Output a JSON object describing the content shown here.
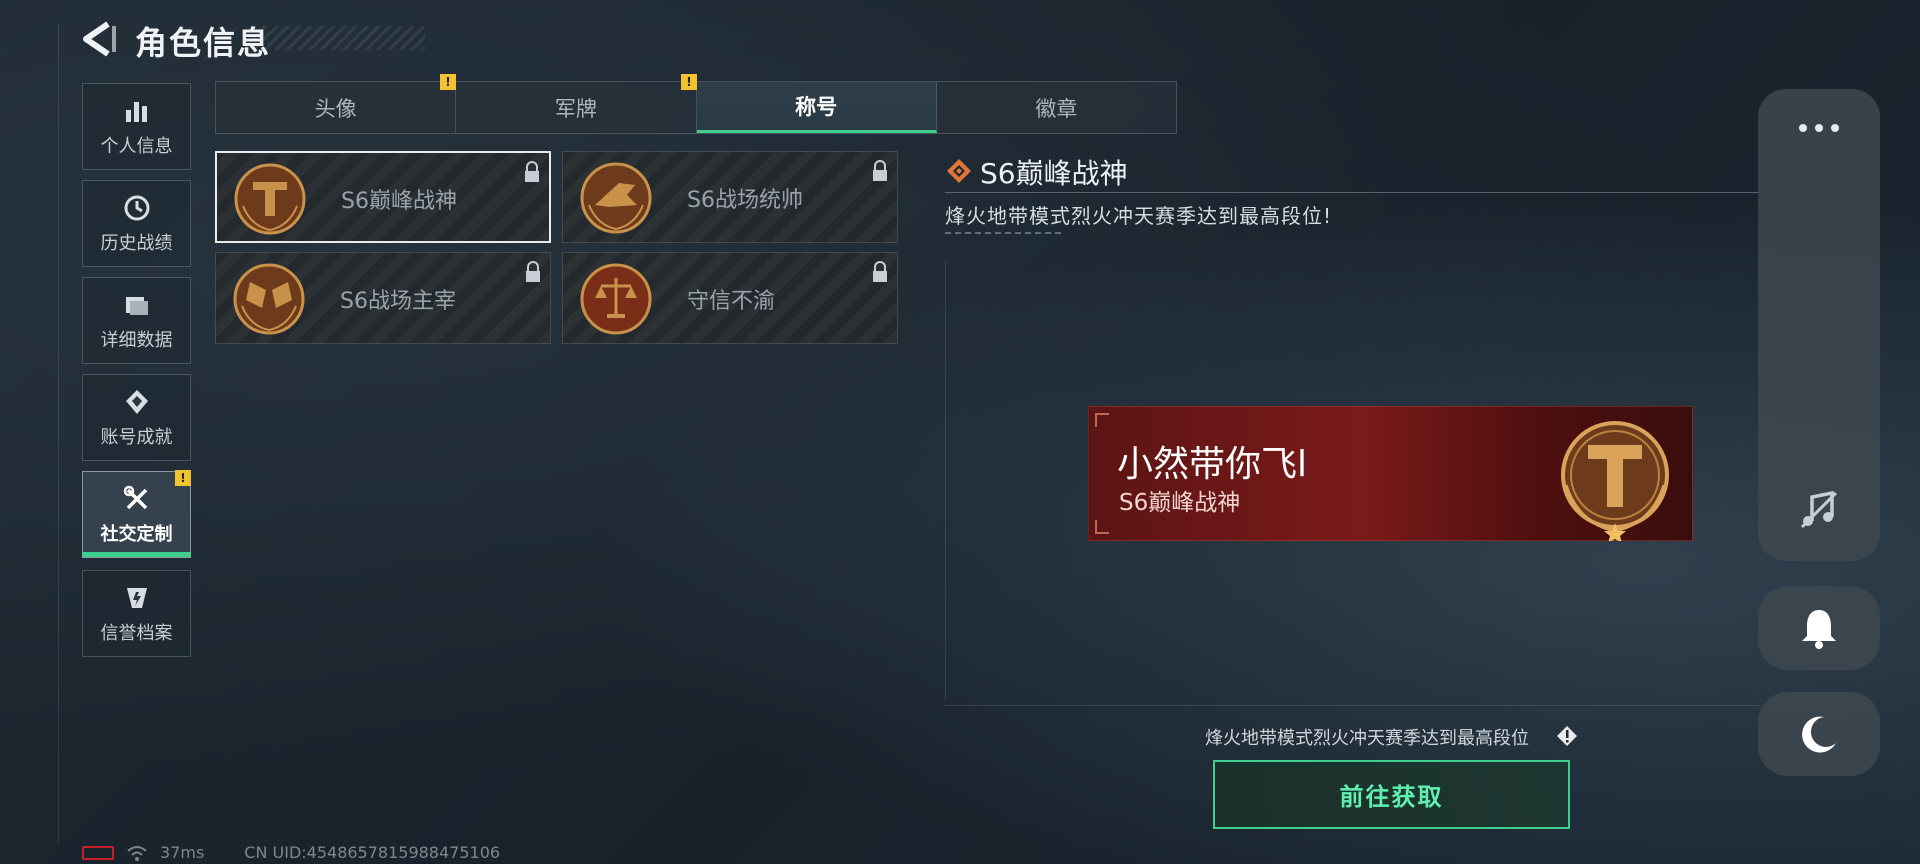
{
  "header": {
    "title": "角色信息"
  },
  "sidebar": {
    "items": [
      {
        "label": "个人信息"
      },
      {
        "label": "历史战绩"
      },
      {
        "label": "详细数据"
      },
      {
        "label": "账号成就"
      },
      {
        "label": "社交定制",
        "badge": "!"
      },
      {
        "label": "信誉档案"
      }
    ]
  },
  "tabs": [
    {
      "label": "头像",
      "badge": "!"
    },
    {
      "label": "军牌",
      "badge": "!"
    },
    {
      "label": "称号"
    },
    {
      "label": "徽章"
    }
  ],
  "titles": [
    {
      "name": "S6巅峰战神"
    },
    {
      "name": "S6战场统帅"
    },
    {
      "name": "S6战场主宰"
    },
    {
      "name": "守信不渝"
    }
  ],
  "detail": {
    "title": "S6巅峰战神",
    "description": "烽火地带模式烈火冲天赛季达到最高段位!"
  },
  "preview": {
    "player_name": "小然带你飞l",
    "title": "S6巅峰战神"
  },
  "requirement": "烽火地带模式烈火冲天赛季达到最高段位",
  "action_button": "前往获取",
  "footer": {
    "ping": "37ms",
    "uid": "CN UID:4548657815988475106"
  },
  "colors": {
    "accent": "#3ccf8e",
    "banner_red": "#7a1a1a",
    "medal_gold": "#c9924a",
    "warning": "#f2c230"
  }
}
